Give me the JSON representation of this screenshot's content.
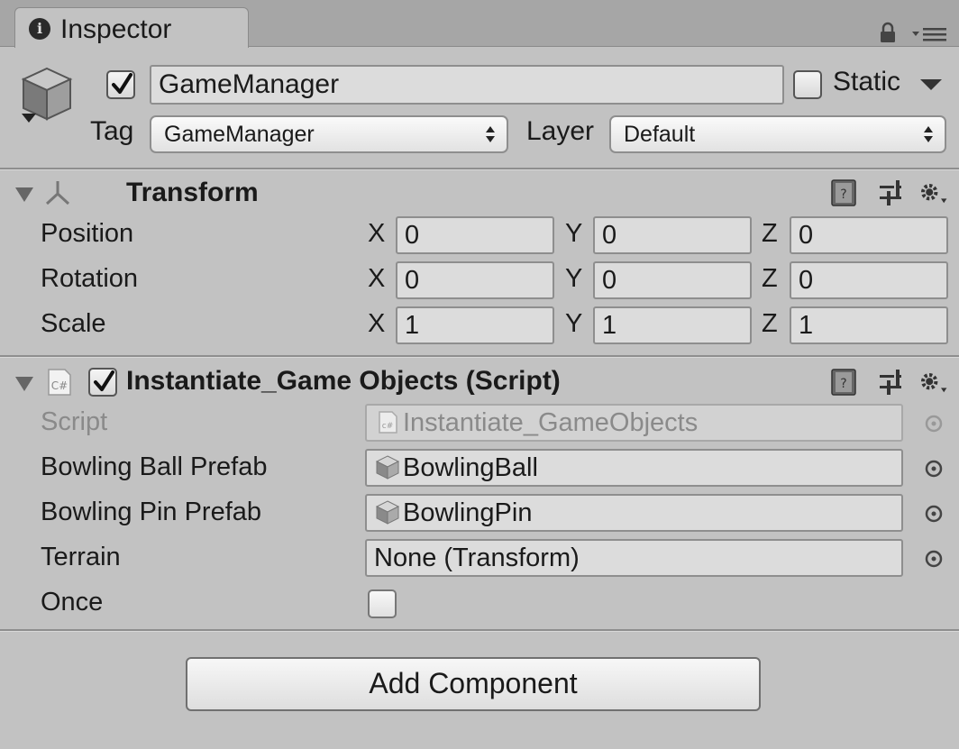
{
  "tab": {
    "title": "Inspector"
  },
  "header": {
    "object_name": "GameManager",
    "active": true,
    "static_label": "Static",
    "static_checked": false,
    "tag_label": "Tag",
    "tag_value": "GameManager",
    "layer_label": "Layer",
    "layer_value": "Default"
  },
  "transform": {
    "title": "Transform",
    "rows": [
      {
        "label": "Position",
        "x": "0",
        "y": "0",
        "z": "0"
      },
      {
        "label": "Rotation",
        "x": "0",
        "y": "0",
        "z": "0"
      },
      {
        "label": "Scale",
        "x": "1",
        "y": "1",
        "z": "1"
      }
    ],
    "axis_labels": {
      "x": "X",
      "y": "Y",
      "z": "Z"
    }
  },
  "script_component": {
    "title": "Instantiate_Game Objects (Script)",
    "icon_text": "C#",
    "enabled": true,
    "fields": [
      {
        "label": "Script",
        "value": "Instantiate_GameObjects",
        "disabled": true,
        "icon": "csharp-file-icon"
      },
      {
        "label": "Bowling Ball Prefab",
        "value": "BowlingBall",
        "icon": "prefab-cube-icon"
      },
      {
        "label": "Bowling Pin Prefab",
        "value": "BowlingPin",
        "icon": "prefab-cube-icon"
      },
      {
        "label": "Terrain",
        "value": "None (Transform)",
        "icon": ""
      }
    ],
    "once_label": "Once",
    "once_checked": false
  },
  "footer": {
    "add_component_label": "Add Component"
  },
  "colors": {
    "background": "#c2c2c2",
    "tabbar": "#a6a6a6",
    "field": "#dcdcdc",
    "border": "#8e8e8e"
  }
}
